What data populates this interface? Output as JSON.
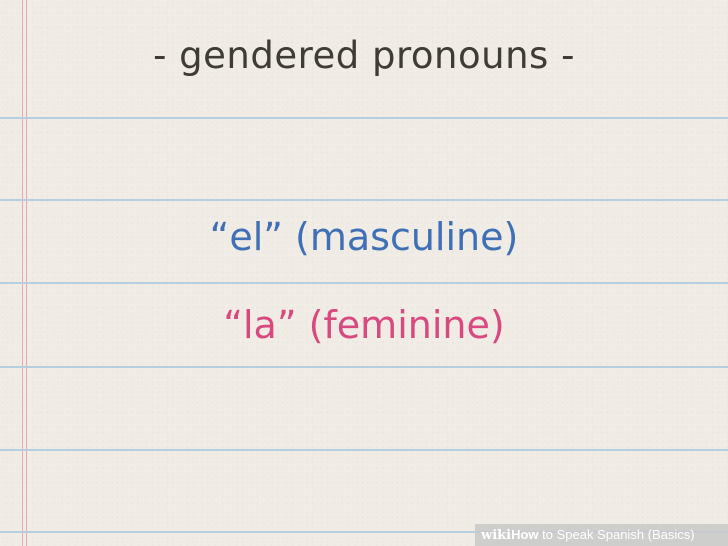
{
  "heading": "- gendered pronouns -",
  "terms": [
    {
      "text": "“el” (masculine)",
      "color": "#3f6fb4"
    },
    {
      "text": "“la” (feminine)",
      "color": "#d7497f"
    }
  ],
  "watermark": {
    "brand_wiki": "wiki",
    "brand_how": "How",
    "article": " to Speak Spanish (Basics)"
  },
  "colors": {
    "paper": "#f1ede6",
    "rule_line": "#b6cfe0",
    "margin_line": "#e7a8b6",
    "heading": "#3f3b36"
  }
}
